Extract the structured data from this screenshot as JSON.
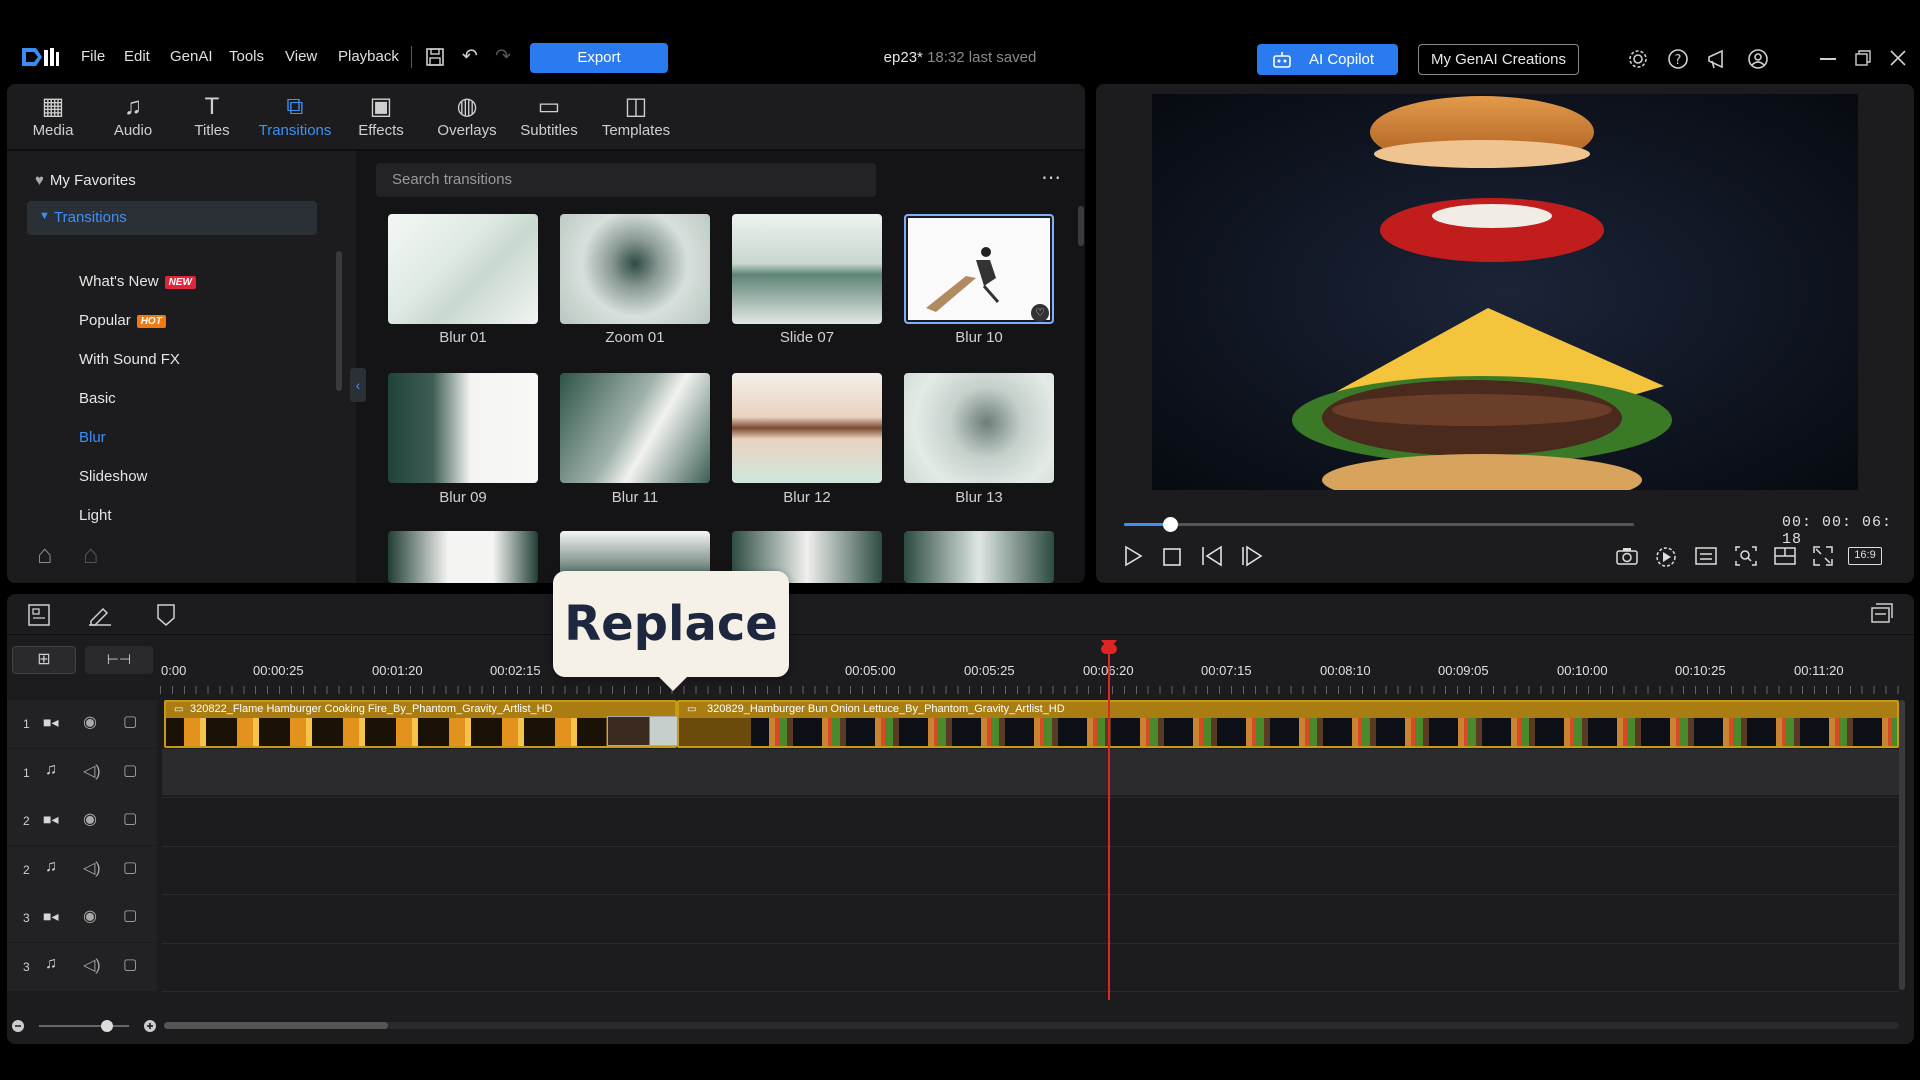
{
  "menu": {
    "file": "File",
    "edit": "Edit",
    "genai": "GenAI",
    "tools": "Tools",
    "view": "View",
    "playback": "Playback"
  },
  "toolbar": {
    "export_label": "Export"
  },
  "project": {
    "name": "ep23*",
    "saved": "18:32 last saved"
  },
  "header_right": {
    "copilot_label": "AI Copilot",
    "creations_label": "My GenAI Creations"
  },
  "library_tabs": [
    {
      "label": "Media",
      "icon": "media-icon"
    },
    {
      "label": "Audio",
      "icon": "audio-icon"
    },
    {
      "label": "Titles",
      "icon": "titles-icon"
    },
    {
      "label": "Transitions",
      "icon": "transitions-icon",
      "active": true
    },
    {
      "label": "Effects",
      "icon": "effects-icon"
    },
    {
      "label": "Overlays",
      "icon": "overlays-icon"
    },
    {
      "label": "Subtitles",
      "icon": "subtitles-icon"
    },
    {
      "label": "Templates",
      "icon": "templates-icon"
    }
  ],
  "sidebar": {
    "favorites": "My Favorites",
    "group": "Transitions",
    "items": [
      {
        "label": "What's New",
        "badge": "NEW"
      },
      {
        "label": "Popular",
        "badge": "HOT"
      },
      {
        "label": "With Sound FX"
      },
      {
        "label": "Basic"
      },
      {
        "label": "Blur",
        "selected": true
      },
      {
        "label": "Slideshow"
      },
      {
        "label": "Light"
      }
    ]
  },
  "search": {
    "placeholder": "Search transitions"
  },
  "transitions": [
    {
      "label": "Blur 01"
    },
    {
      "label": "Zoom 01"
    },
    {
      "label": "Slide 07"
    },
    {
      "label": "Blur 10",
      "selected": true
    },
    {
      "label": "Blur 09"
    },
    {
      "label": "Blur 11"
    },
    {
      "label": "Blur 12"
    },
    {
      "label": "Blur 13"
    }
  ],
  "preview": {
    "timecode": "00: 00: 06: 18",
    "aspect": "16:9",
    "progress": 0.09
  },
  "ruler": [
    "0:00",
    "00:00:25",
    "00:01:20",
    "00:02:15",
    "00:05:00",
    "00:05:25",
    "00:06:20",
    "00:07:15",
    "00:08:10",
    "00:09:05",
    "00:10:00",
    "00:10:25",
    "00:11:20"
  ],
  "clips": {
    "clip1": "320822_Flame Hamburger Cooking Fire_By_Phantom_Gravity_Artlist_HD",
    "clip2": "320829_Hamburger Bun Onion Lettuce_By_Phantom_Gravity_Artlist_HD"
  },
  "tracks": [
    {
      "num": "1",
      "kind": "video"
    },
    {
      "num": "1",
      "kind": "audio"
    },
    {
      "num": "2",
      "kind": "video"
    },
    {
      "num": "2",
      "kind": "audio"
    },
    {
      "num": "3",
      "kind": "video"
    },
    {
      "num": "3",
      "kind": "audio"
    }
  ],
  "callout": {
    "text": "Replace"
  }
}
